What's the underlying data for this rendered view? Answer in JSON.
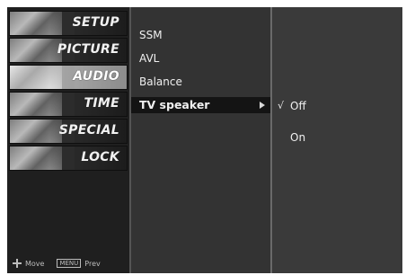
{
  "categories": [
    {
      "label": "SETUP",
      "icon": "setup-icon"
    },
    {
      "label": "PICTURE",
      "icon": "picture-icon"
    },
    {
      "label": "AUDIO",
      "icon": "audio-icon",
      "selected": true
    },
    {
      "label": "TIME",
      "icon": "time-icon"
    },
    {
      "label": "SPECIAL",
      "icon": "special-icon"
    },
    {
      "label": "LOCK",
      "icon": "lock-icon"
    }
  ],
  "hint": {
    "move": "Move",
    "menu_key": "MENU",
    "prev": "Prev"
  },
  "submenu": {
    "items": [
      {
        "label": "SSM"
      },
      {
        "label": "AVL"
      },
      {
        "label": "Balance"
      },
      {
        "label": "TV speaker",
        "selected": true
      }
    ]
  },
  "options": {
    "items": [
      {
        "label": "Off",
        "checked": true,
        "check_mark": "√"
      },
      {
        "label": "On",
        "checked": false,
        "check_mark": ""
      }
    ]
  }
}
